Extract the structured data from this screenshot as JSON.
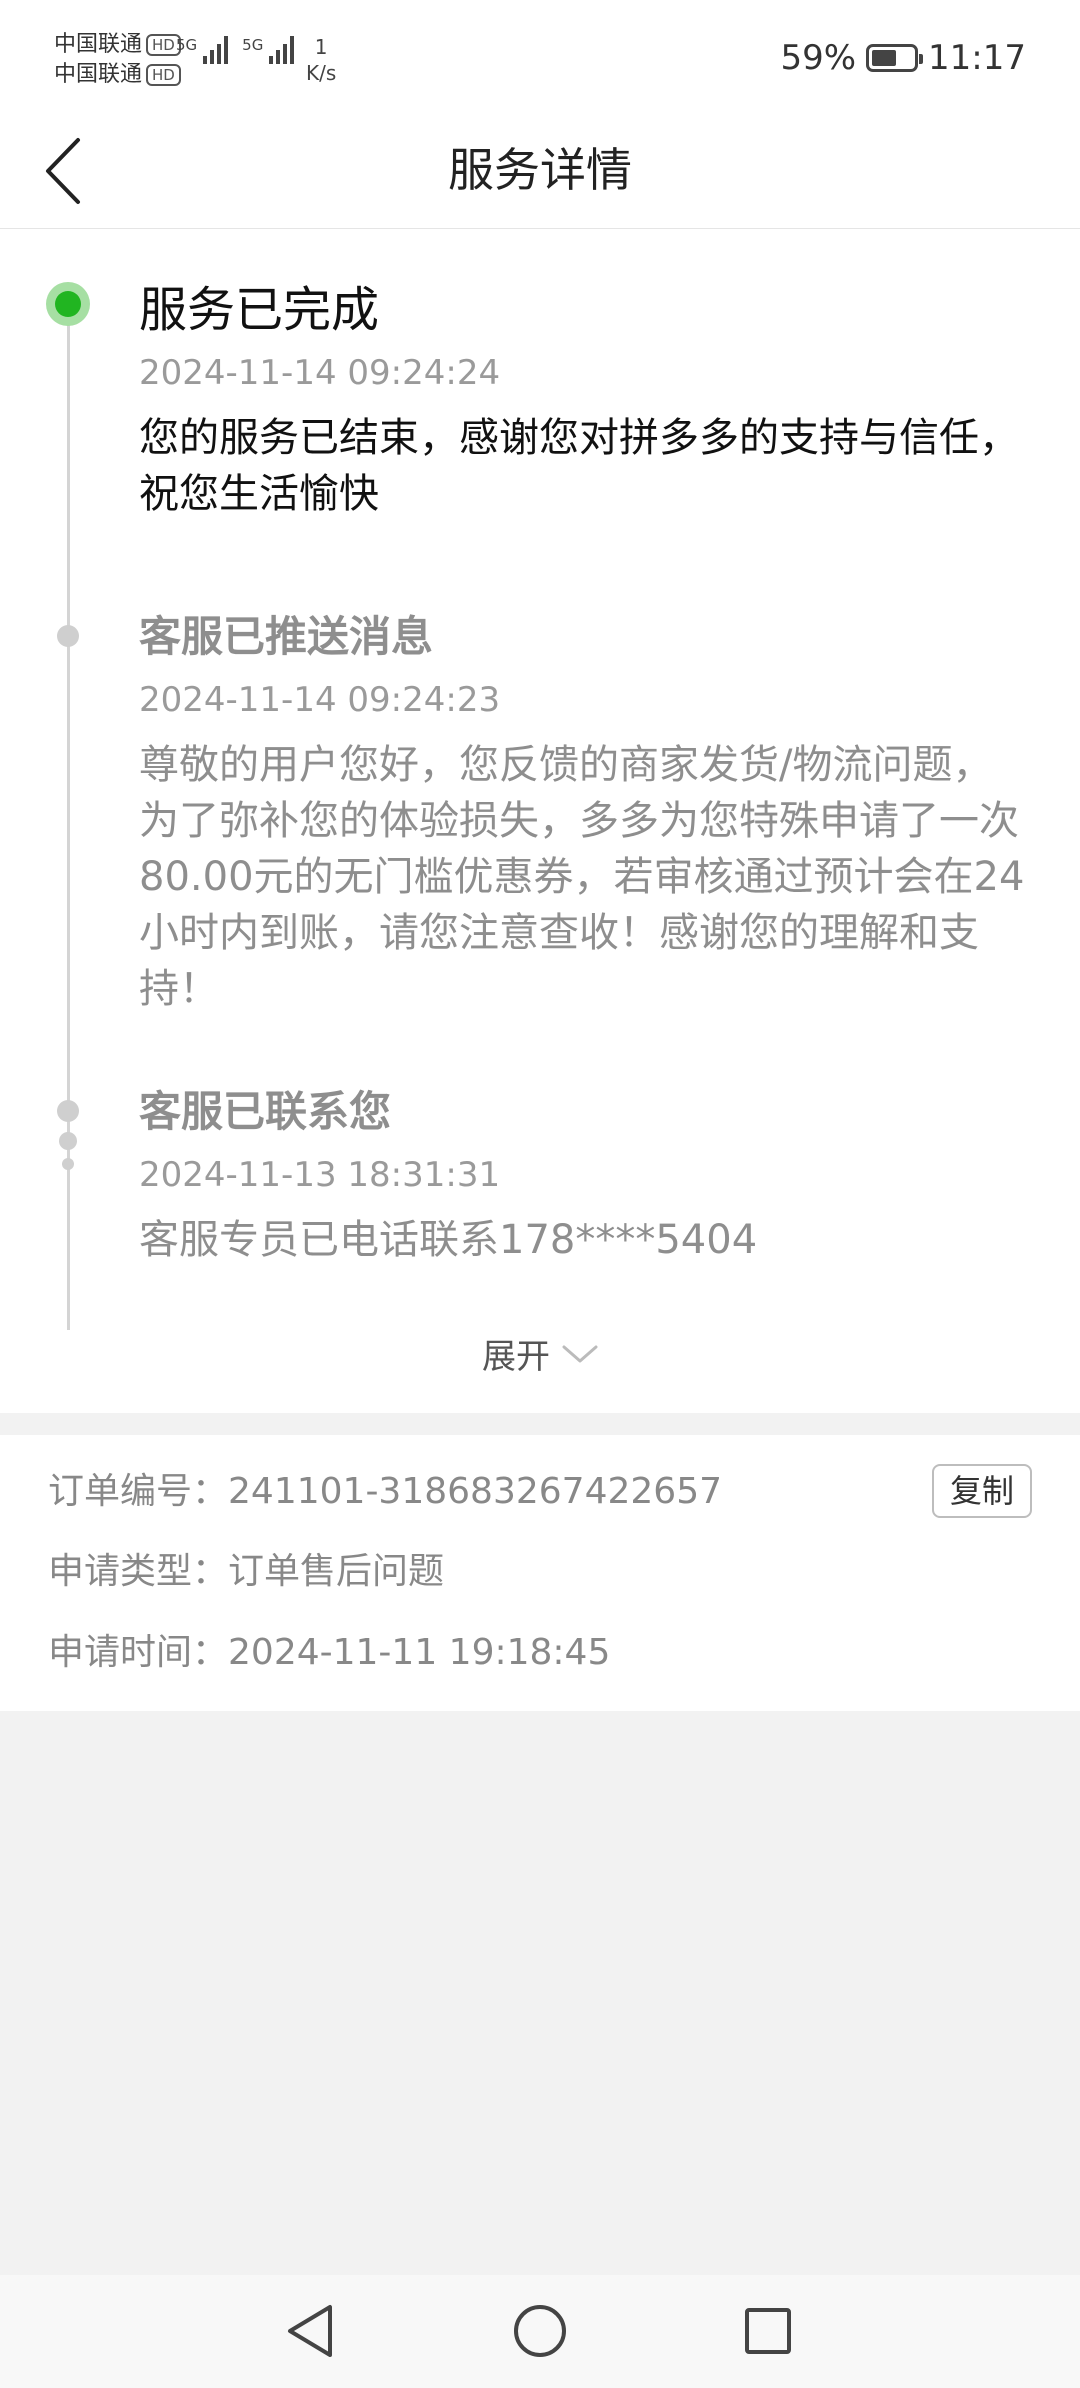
{
  "status_bar": {
    "carrier_1": "中国联通",
    "carrier_2": "中国联通",
    "hd_badge": "HD",
    "network_1": "5G",
    "network_2": "5G",
    "net_speed_value": "1",
    "net_speed_unit": "K/s",
    "battery_percent": "59%",
    "battery_level": 0.59,
    "time": "11:17"
  },
  "header": {
    "back_icon": "chevron-left-icon",
    "title": "服务详情"
  },
  "timeline": {
    "events": [
      {
        "title": "服务已完成",
        "time": "2024-11-14 09:24:24",
        "text": "您的服务已结束，感谢您对拼多多的支持与信任，祝您生活愉快",
        "status": "current",
        "dot_color": "#21b521"
      },
      {
        "title": "客服已推送消息",
        "time": "2024-11-14 09:24:23",
        "text": "尊敬的用户您好，您反馈的商家发货/物流问题，为了弥补您的体验损失，多多为您特殊申请了一次80.00元的无门槛优惠券，若审核通过预计会在24小时内到账，请您注意查收！感谢您的理解和支持！",
        "status": "past"
      },
      {
        "title": "客服已联系您",
        "time": "2024-11-13 18:31:31",
        "text": "客服专员已电话联系178****5404",
        "status": "past"
      }
    ],
    "expand_label": "展开",
    "expand_icon": "chevron-down-icon"
  },
  "order_info": {
    "order_no_label": "订单编号：",
    "order_no": "241101-318683267422657",
    "copy_label": "复制",
    "apply_type_label": "申请类型：",
    "apply_type": "订单售后问题",
    "apply_time_label": "申请时间：",
    "apply_time": "2024-11-11 19:18:45"
  },
  "system_nav": {
    "back": "triangle-back-icon",
    "home": "circle-home-icon",
    "recent": "square-recent-icon"
  },
  "colors": {
    "accent_green": "#21b521",
    "muted_text": "#8e8e8e",
    "background": "#f2f2f2"
  }
}
